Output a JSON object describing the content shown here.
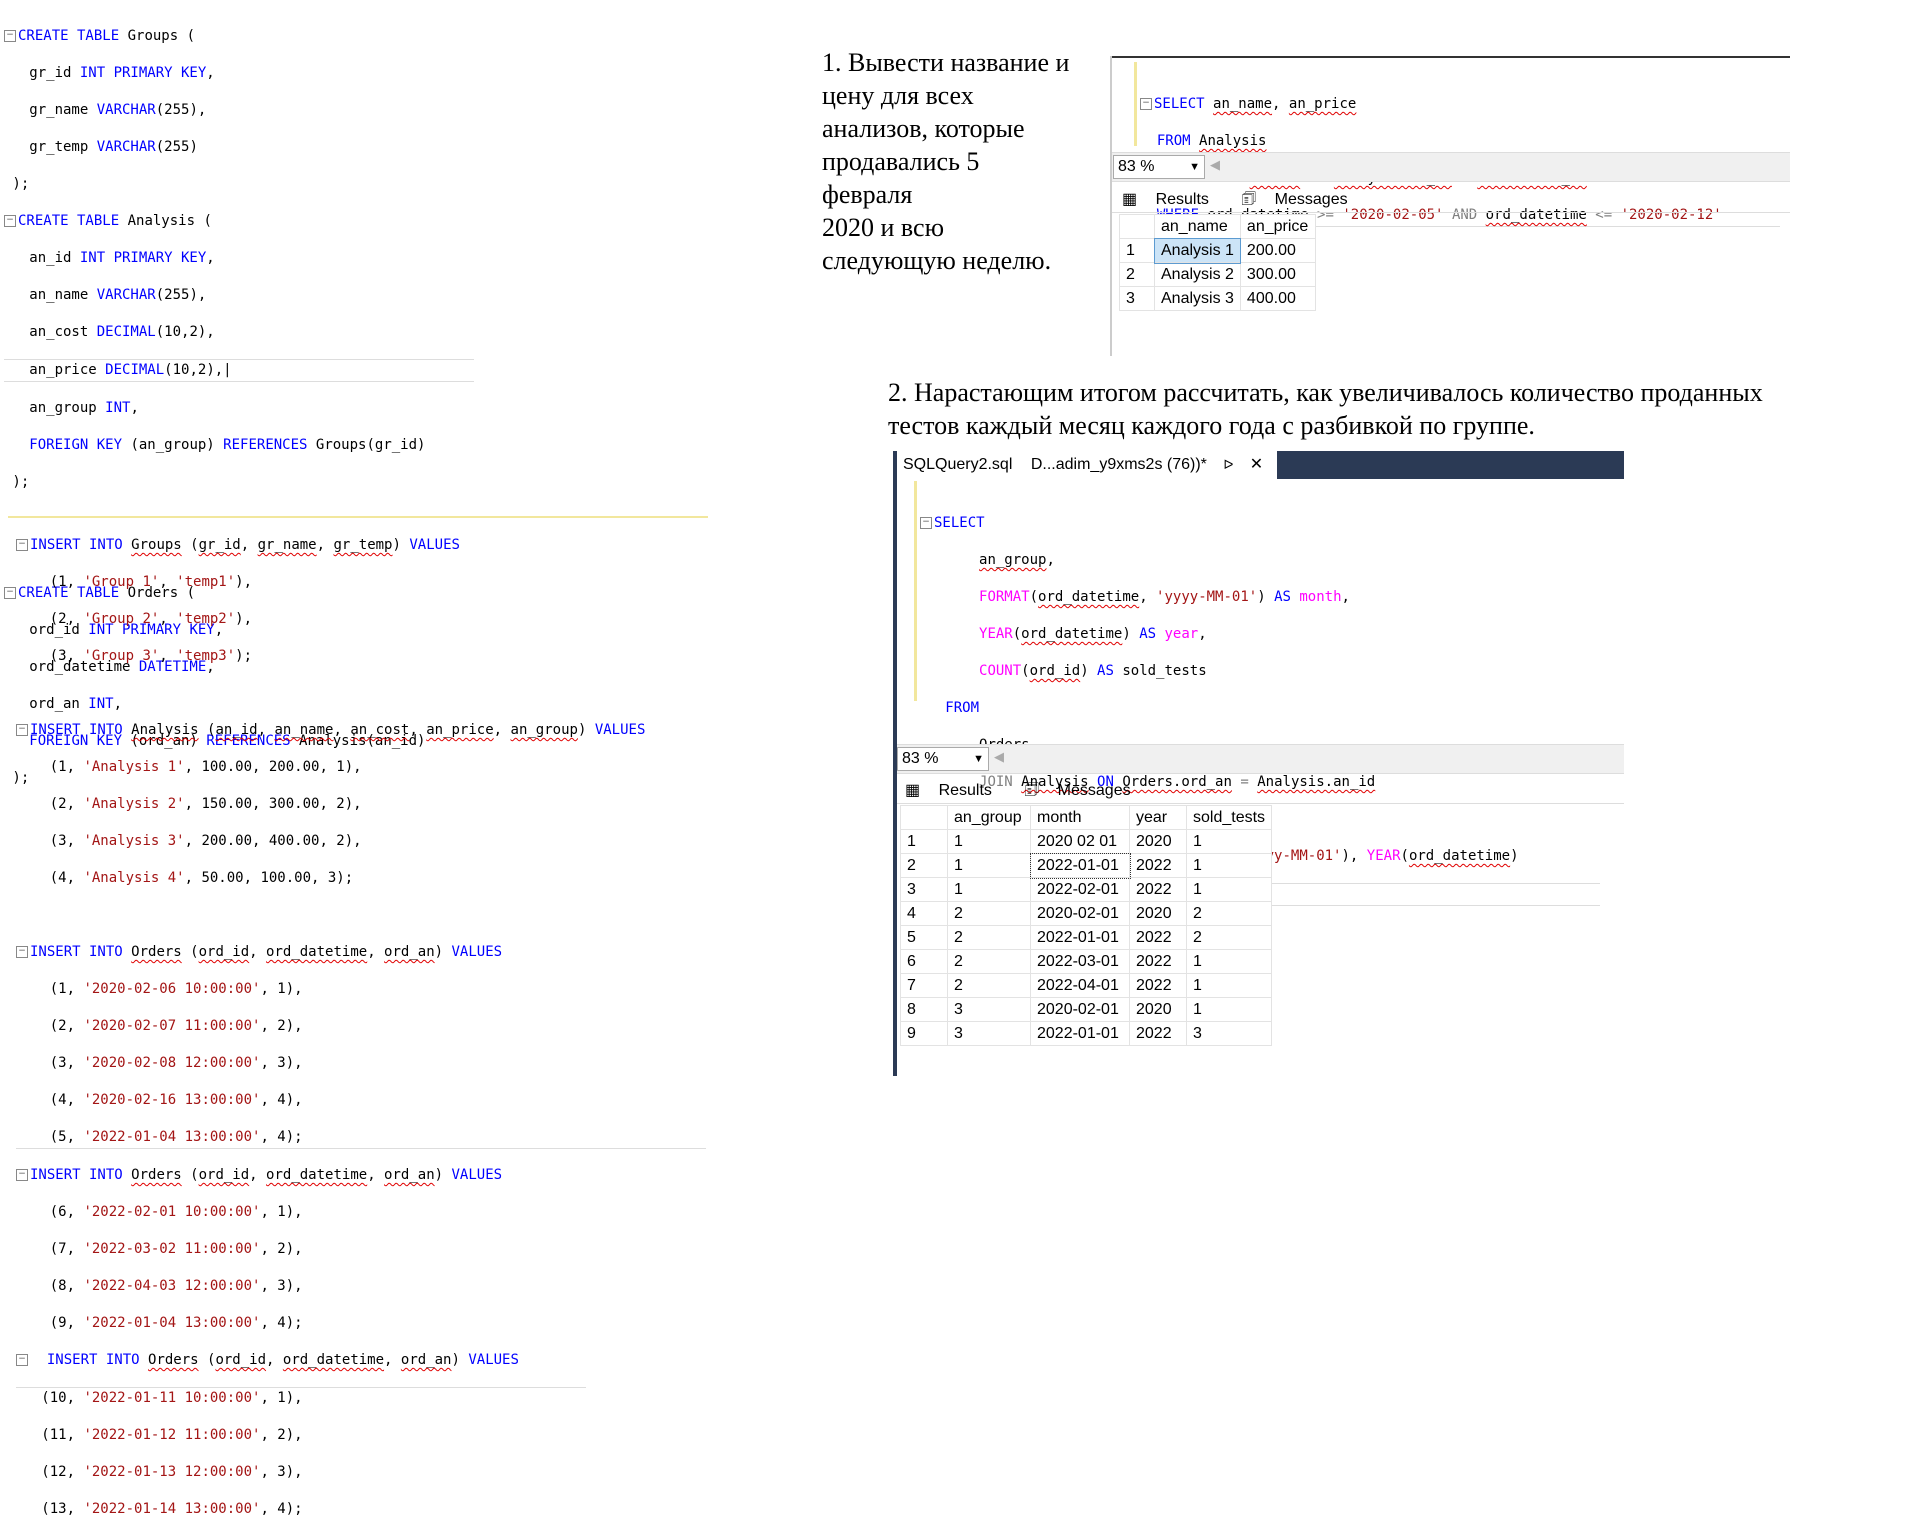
{
  "tasks": {
    "task1": [
      "1. Вывести название и",
      "цену для всех",
      "анализов, которые",
      "продавались 5",
      "февраля",
      "2020 и всю",
      "следующую неделю."
    ],
    "task2": [
      "2. Нарастающим итогом рассчитать, как увеличивалось количество проданных",
      "тестов каждый месяц каждого года с разбивкой по группе."
    ]
  },
  "query1": {
    "zoom": "83 %",
    "tab_results": "Results",
    "tab_messages": "Messages",
    "columns": [
      "an_name",
      "an_price"
    ],
    "rows": [
      {
        "n": "1",
        "an_name": "Analysis 1",
        "an_price": "200.00"
      },
      {
        "n": "2",
        "an_name": "Analysis 2",
        "an_price": "300.00"
      },
      {
        "n": "3",
        "an_name": "Analysis 3",
        "an_price": "400.00"
      }
    ]
  },
  "query2": {
    "tab_title": "SQLQuery2.sql",
    "tab_sub": "D...adim_y9xms2s (76))*",
    "pin": "ᐅ",
    "close": "✕",
    "zoom": "83 %",
    "tab_results": "Results",
    "tab_messages": "Messages",
    "columns": [
      "an_group",
      "month",
      "year",
      "sold_tests"
    ],
    "rows": [
      {
        "n": "1",
        "an_group": "1",
        "month": "2020 02 01",
        "year": "2020",
        "sold_tests": "1"
      },
      {
        "n": "2",
        "an_group": "1",
        "month": "2022-01-01",
        "year": "2022",
        "sold_tests": "1"
      },
      {
        "n": "3",
        "an_group": "1",
        "month": "2022-02-01",
        "year": "2022",
        "sold_tests": "1"
      },
      {
        "n": "4",
        "an_group": "2",
        "month": "2020-02-01",
        "year": "2020",
        "sold_tests": "2"
      },
      {
        "n": "5",
        "an_group": "2",
        "month": "2022-01-01",
        "year": "2022",
        "sold_tests": "2"
      },
      {
        "n": "6",
        "an_group": "2",
        "month": "2022-03-01",
        "year": "2022",
        "sold_tests": "1"
      },
      {
        "n": "7",
        "an_group": "2",
        "month": "2022-04-01",
        "year": "2022",
        "sold_tests": "1"
      },
      {
        "n": "8",
        "an_group": "3",
        "month": "2020-02-01",
        "year": "2020",
        "sold_tests": "1"
      },
      {
        "n": "9",
        "an_group": "3",
        "month": "2022-01-01",
        "year": "2022",
        "sold_tests": "3"
      }
    ]
  }
}
